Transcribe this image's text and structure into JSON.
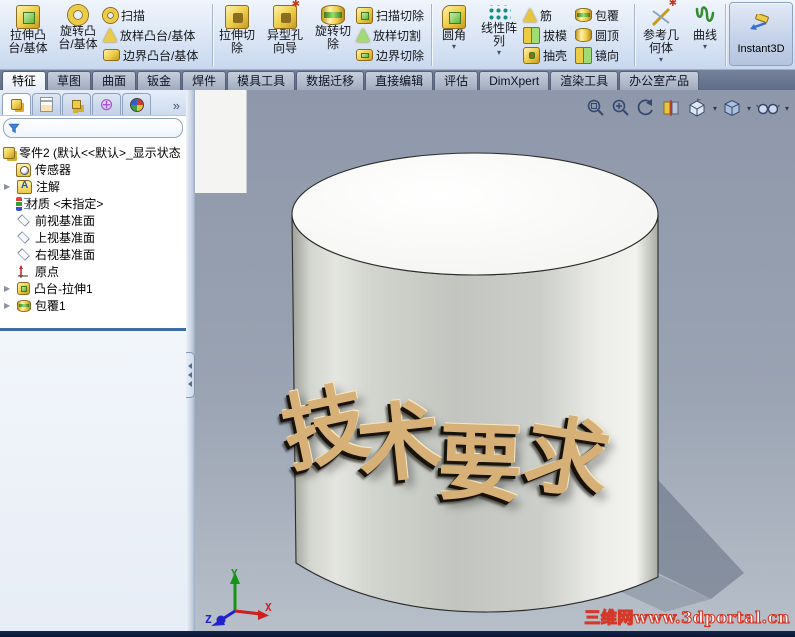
{
  "app": {
    "name_visible": false
  },
  "colors": {
    "ribbon_bg_top": "#f0f5fc",
    "ribbon_bg_bottom": "#c8d8ee",
    "tabstrip_bg": "#65728c",
    "gold_icon": "#eccb45",
    "green_accent": "#5cb838",
    "viewport_top": "#8e98aa",
    "viewport_bottom": "#b7bfc9",
    "wrap_text_gold": "#d7b078",
    "watermark_red": "#d43828",
    "bottom_bar_navy": "#0e1d3f",
    "tree_separator_blue": "#3a6ea5"
  },
  "ribbon": {
    "buttons": {
      "extrude_boss": {
        "line1": "拉伸凸",
        "line2": "台/基体"
      },
      "revolve_boss": {
        "line1": "旋转凸",
        "line2": "台/基体"
      },
      "sweep": "扫描",
      "loft_boss": "放样凸台/基体",
      "boundary_boss": "边界凸台/基体",
      "extrude_cut": {
        "line1": "拉伸切",
        "line2": "除"
      },
      "hole_wizard": {
        "line1": "异型孔",
        "line2": "向导"
      },
      "revolve_cut": {
        "line1": "旋转切",
        "line2": "除"
      },
      "sweep_cut": "扫描切除",
      "loft_cut": "放样切割",
      "boundary_cut": "边界切除",
      "fillet": "圆角",
      "linear_pattern": {
        "line1": "线性阵",
        "line2": "列"
      },
      "rib": "筋",
      "draft": "拔模",
      "shell": "抽壳",
      "wrap": "包覆",
      "dome": "圆顶",
      "mirror": "镜向",
      "reference_geometry": {
        "line1": "参考几",
        "line2": "何体"
      },
      "curves": "曲线",
      "instant3d": "Instant3D"
    },
    "dropdown_glyph": "▾",
    "tabs": [
      "特征",
      "草图",
      "曲面",
      "钣金",
      "焊件",
      "模具工具",
      "数据迁移",
      "直接编辑",
      "评估",
      "DimXpert",
      "渲染工具",
      "办公室产品"
    ],
    "active_tab": "特征"
  },
  "panel": {
    "tab_icons": [
      "featuremanager-tree",
      "propertymanager",
      "configurationmanager",
      "dimxpertmanager",
      "displaymanager"
    ],
    "overflow_glyph": "»",
    "dimxpert_glyph": "⊕",
    "expander_glyph": "▶",
    "tree": {
      "root": "零件2 (默认<<默认>_显示状态",
      "items": [
        {
          "label": "传感器",
          "icon": "sensors-folder-icon"
        },
        {
          "label": "注解",
          "icon": "annotations-folder-icon",
          "expandable": true
        },
        {
          "label": "材质 <未指定>",
          "icon": "material-icon"
        },
        {
          "label": "前视基准面",
          "icon": "plane-icon"
        },
        {
          "label": "上视基准面",
          "icon": "plane-icon"
        },
        {
          "label": "右视基准面",
          "icon": "plane-icon"
        },
        {
          "label": "原点",
          "icon": "origin-icon"
        },
        {
          "label": "凸台-拉伸1",
          "icon": "boss-extrude-icon",
          "expandable": true
        },
        {
          "label": "包覆1",
          "icon": "wrap-feature-icon",
          "expandable": true
        }
      ]
    }
  },
  "viewport": {
    "hud_icons": [
      "zoom-to-fit",
      "zoom-to-area",
      "previous-view",
      "section-view",
      "view-orientation",
      "display-style",
      "hide-show-items",
      "edit-appearance"
    ],
    "wrap_text": "技术要求",
    "chars": {
      "c1": "技",
      "c2": "术",
      "c3": "要",
      "c4": "求"
    },
    "triad": {
      "x": "X",
      "y": "Y",
      "z": "Z"
    },
    "watermark": "三维网www.3dportal.cn"
  }
}
